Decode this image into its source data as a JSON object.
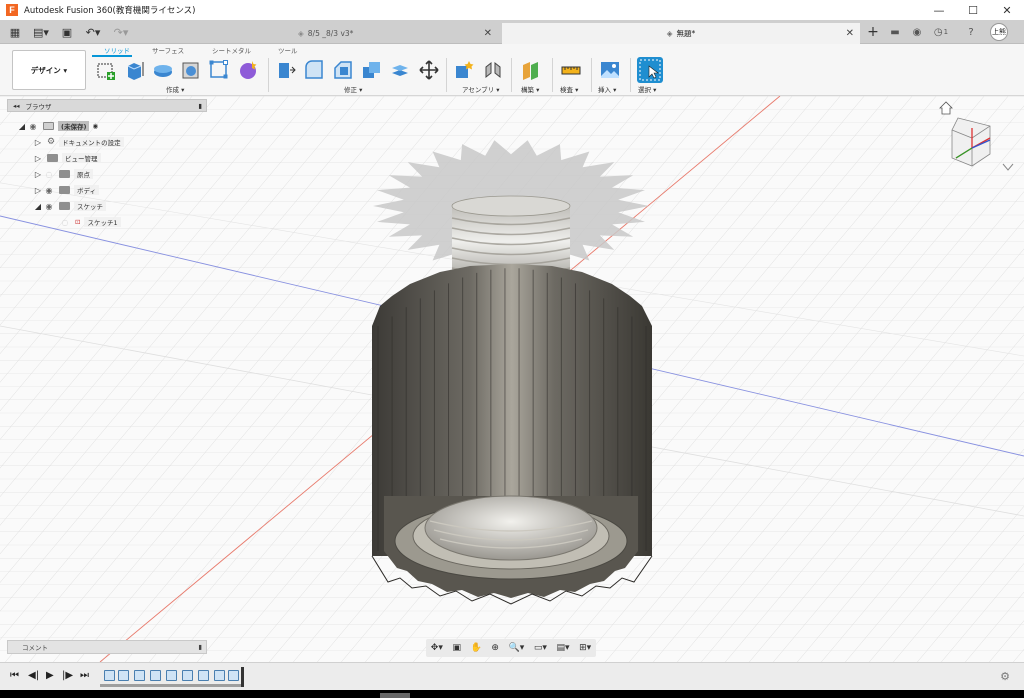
{
  "app": {
    "title": "Autodesk Fusion 360(教育機関ライセンス)",
    "logo": "F"
  },
  "window": {
    "minimize": "—",
    "maximize": "☐",
    "close": "✕"
  },
  "tabs": [
    {
      "label": "8/5 _8/3 v3*",
      "active": false
    },
    {
      "label": "無題*",
      "active": true
    }
  ],
  "header_right": {
    "notifications": "1",
    "user_initials": "上熊"
  },
  "ribbon": {
    "workspace": "デザイン ▾",
    "tabs": [
      "ソリッド",
      "サーフェス",
      "シートメタル",
      "ツール"
    ],
    "groups": [
      "作成 ▾",
      "修正 ▾",
      "アセンブリ ▾",
      "構築 ▾",
      "検査 ▾",
      "挿入 ▾",
      "選択 ▾"
    ]
  },
  "browser": {
    "title": "ブラウザ",
    "items": [
      {
        "label": "(未保存)"
      },
      {
        "label": "ドキュメントの設定"
      },
      {
        "label": "ビュー管理"
      },
      {
        "label": "原点"
      },
      {
        "label": "ボディ"
      },
      {
        "label": "スケッチ"
      },
      {
        "label": "スケッチ1"
      }
    ]
  },
  "comment": {
    "label": "コメント"
  },
  "colors": {
    "accent": "#0696d7",
    "logo": "#f26722",
    "grid": "#dcdcdc",
    "red_axis": "#e87a6c",
    "blue_axis": "#8891e0"
  },
  "icons": [
    "grid-menu-icon",
    "file-icon",
    "save-icon",
    "undo-icon",
    "redo-icon",
    "orbit-icon",
    "pan-icon",
    "zoom-icon",
    "display-settings-icon",
    "play-icon",
    "gear-icon",
    "viewcube-icon",
    "home-icon"
  ]
}
